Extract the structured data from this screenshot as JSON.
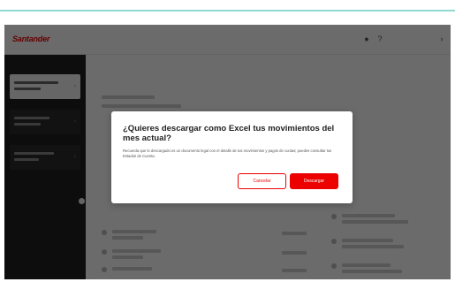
{
  "modal": {
    "title": "¿Quieres descargar como Excel tus movimientos del mes actual?",
    "body": "Recuerda que lo descargado es un documento legal con el detalle de tus movimientos y pagos de cuotas; puedes consultar tus Estados de Cuenta.",
    "cancel_label": "Cancelar",
    "download_label": "Descargar"
  },
  "colors": {
    "brand": "#ec0000",
    "overlay": "rgba(0,0,0,0.58)",
    "sidebar": "#1f1f1f"
  }
}
